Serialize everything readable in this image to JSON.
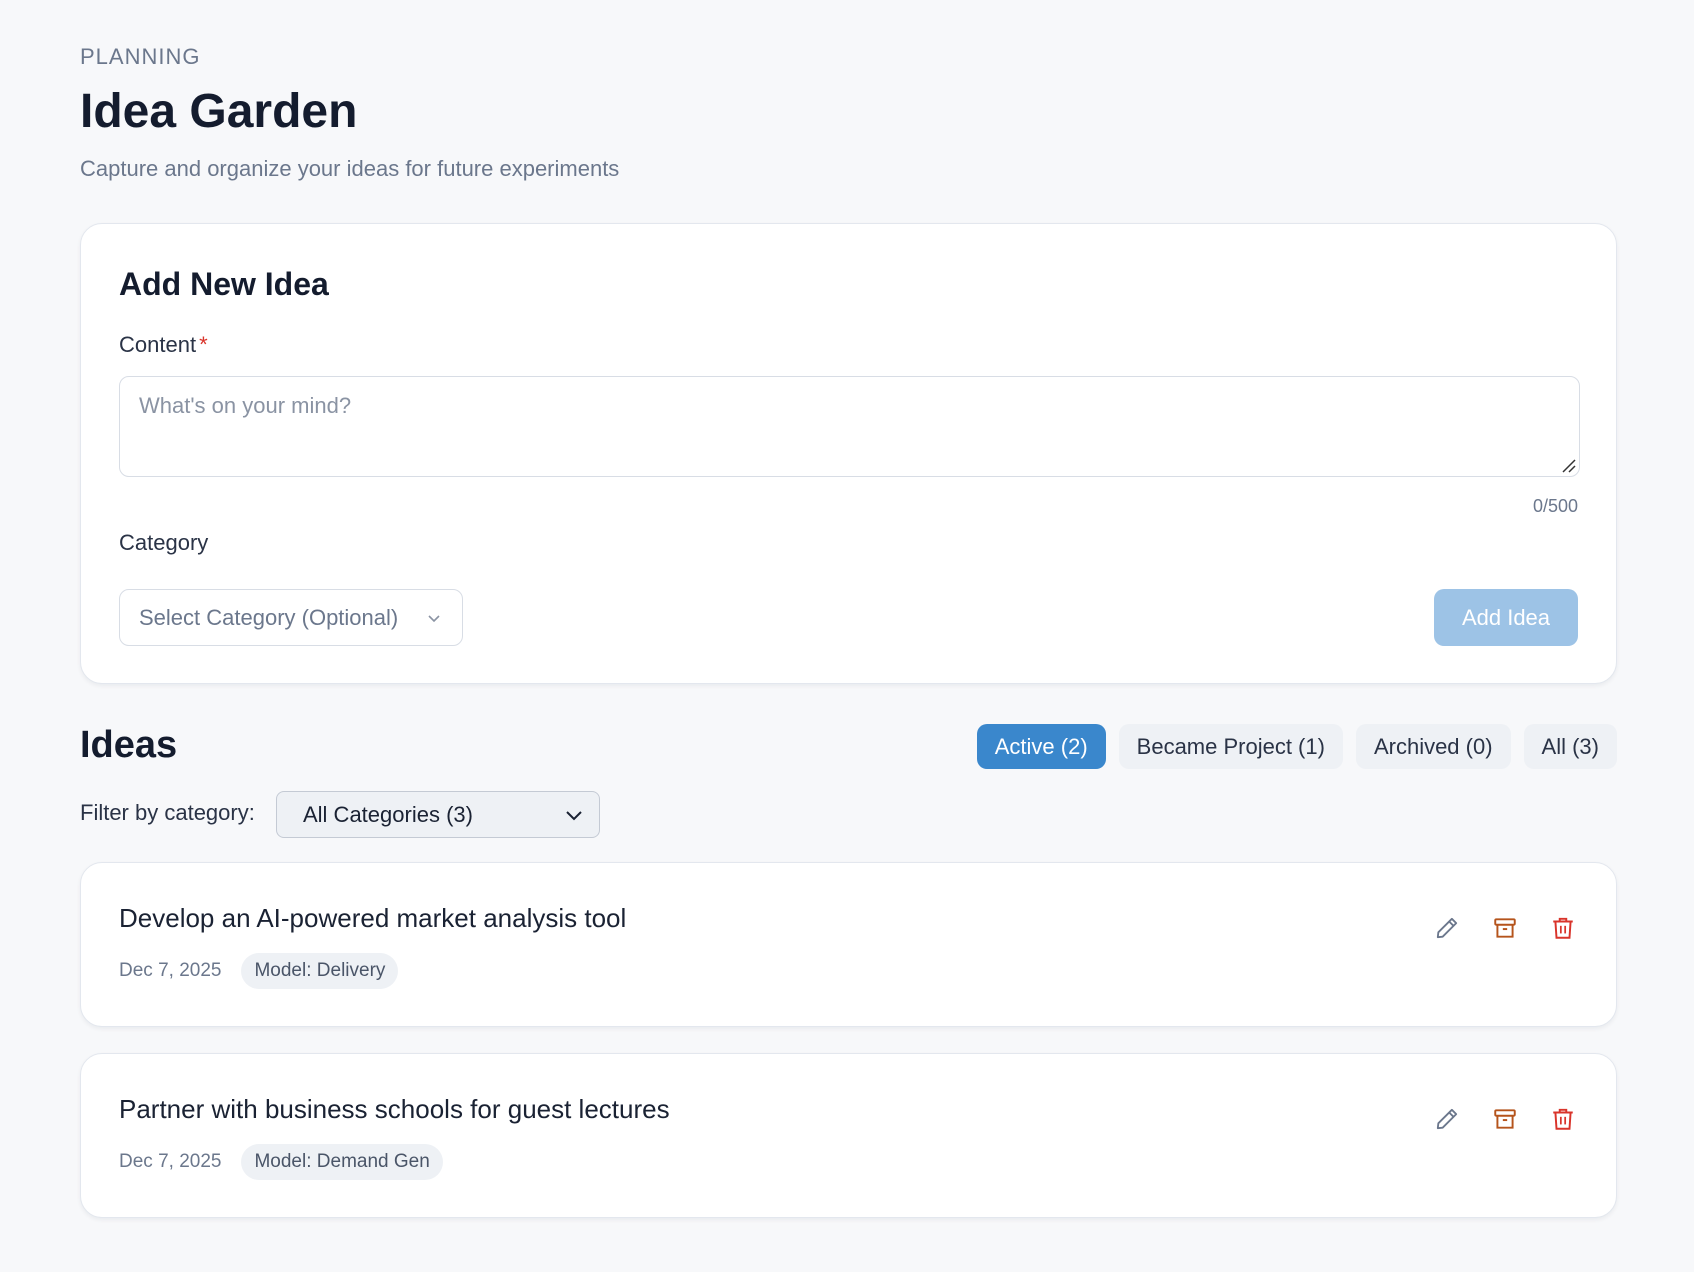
{
  "header": {
    "eyebrow": "PLANNING",
    "title": "Idea Garden",
    "subtitle": "Capture and organize your ideas for future experiments"
  },
  "add_form": {
    "title": "Add New Idea",
    "content_label": "Content",
    "required_mark": "*",
    "content_placeholder": "What's on your mind?",
    "counter": "0/500",
    "category_label": "Category",
    "category_placeholder": "Select Category (Optional)",
    "submit_label": "Add Idea"
  },
  "ideas_section": {
    "title": "Ideas",
    "tabs": [
      {
        "label": "Active (2)",
        "active": true
      },
      {
        "label": "Became Project (1)",
        "active": false
      },
      {
        "label": "Archived (0)",
        "active": false
      },
      {
        "label": "All (3)",
        "active": false
      }
    ],
    "filter_label": "Filter by category:",
    "filter_value": "All Categories (3)",
    "items": [
      {
        "text": "Develop an AI-powered market analysis tool",
        "date": "Dec 7, 2025",
        "category": "Model: Delivery"
      },
      {
        "text": "Partner with business schools for guest lectures",
        "date": "Dec 7, 2025",
        "category": "Model: Demand Gen"
      }
    ]
  },
  "icons": {
    "edit": "pencil-icon",
    "archive": "archive-box-icon",
    "delete": "trash-icon",
    "dropdown": "chevron-down-icon"
  },
  "colors": {
    "accent": "#3a87cc",
    "accent_disabled": "#9dc3e6",
    "required": "#d9342b",
    "archive_icon": "#b5541c",
    "delete_icon": "#d9342b"
  }
}
